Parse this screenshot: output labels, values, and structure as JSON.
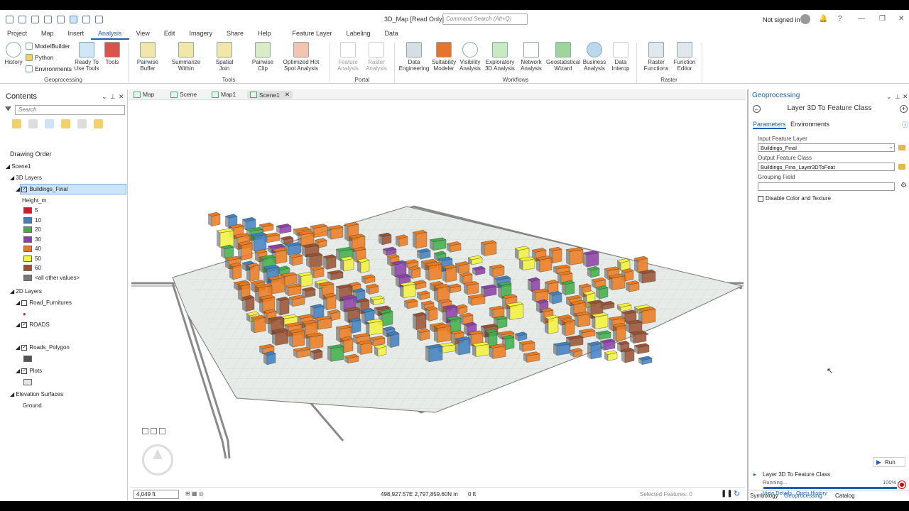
{
  "window": {
    "title": "3D_Map [Read Only]",
    "command_search": "Command Search (Alt+Q)",
    "not_signed_in": "Not signed in"
  },
  "menu": {
    "tabs": [
      "Project",
      "Map",
      "Insert",
      "Analysis",
      "View",
      "Edit",
      "Imagery",
      "Share",
      "Help"
    ],
    "active": "Analysis",
    "context_tabs": [
      "Feature Layer",
      "Labeling",
      "Data"
    ]
  },
  "ribbon": {
    "history": "History",
    "modelbuilder": "ModelBuilder",
    "python": "Python",
    "environments": "Environments",
    "ready_tools": "Ready To\nUse Tools",
    "tools": "Tools",
    "group_geoprocessing": "Geoprocessing",
    "pairwise_buffer": "Pairwise\nBuffer",
    "summarize_within": "Summarize\nWithin",
    "spatial_join": "Spatial\nJoin",
    "pairwise_clip": "Pairwise\nClip",
    "hotspot": "Optimized Hot\nSpot Analysis",
    "group_tools": "Tools",
    "feature_analysis": "Feature\nAnalysis",
    "raster_analysis": "Raster\nAnalysis",
    "group_portal": "Portal",
    "data_engineering": "Data\nEngineering",
    "suitability": "Suitability\nModeler",
    "visibility": "Visibility\nAnalysis",
    "exploratory": "Exploratory\n3D Analysis",
    "network": "Network\nAnalysis",
    "geostatistical": "Geostatistical\nWizard",
    "business": "Business\nAnalysis",
    "data_interop": "Data\nInterop",
    "group_workflows": "Workflows",
    "raster_functions": "Raster\nFunctions",
    "function_editor": "Function\nEditor",
    "group_raster": "Raster"
  },
  "contents": {
    "title": "Contents",
    "search_placeholder": "Search",
    "drawing_order": "Drawing Order",
    "scene": "Scene1",
    "layers_3d": "3D Layers",
    "buildings": "Buildings_Final",
    "height_field": "Height_m",
    "legend": [
      {
        "label": "5",
        "color": "#d11a2a"
      },
      {
        "label": "10",
        "color": "#3f7fc0"
      },
      {
        "label": "20",
        "color": "#3fae49"
      },
      {
        "label": "30",
        "color": "#8b3fa8"
      },
      {
        "label": "40",
        "color": "#ec7a1c"
      },
      {
        "label": "50",
        "color": "#f3f33b"
      },
      {
        "label": "60",
        "color": "#9a5130"
      },
      {
        "label": "<all other values>",
        "color": "#777777"
      }
    ],
    "layers_2d": "2D Layers",
    "road_furnitures": "Road_Furnitures",
    "roads": "ROADS",
    "roads_polygon": "Roads_Polygon",
    "plots": "Plots",
    "elevation_surfaces": "Elevation Surfaces",
    "ground": "Ground"
  },
  "view_tabs": [
    "Map",
    "Scene",
    "Map1",
    "Scene1"
  ],
  "status": {
    "scale": "4,049 ft",
    "coords": "498,927.57E 2,797,859.60N m",
    "elevation": "0 ft",
    "selected": "Selected Features: 0"
  },
  "gp": {
    "title": "Geoprocessing",
    "tool": "Layer 3D To Feature Class",
    "tab_params": "Parameters",
    "tab_env": "Environments",
    "input_label": "Input Feature Layer",
    "input_value": "Buildings_Final",
    "output_label": "Output Feature Class",
    "output_value": "Buildings_Fina_Layer3DToFeat",
    "grouping_label": "Grouping Field",
    "grouping_value": "",
    "disable_label": "Disable Color and Texture",
    "run": "Run",
    "job_name": "Layer 3D To Feature Class",
    "job_status": "Running...",
    "job_progress": "100%",
    "view_details": "View Details",
    "open_history": "Open History",
    "bottom_tabs": [
      "Symbology",
      "Geoprocessing",
      "Catalog"
    ]
  }
}
